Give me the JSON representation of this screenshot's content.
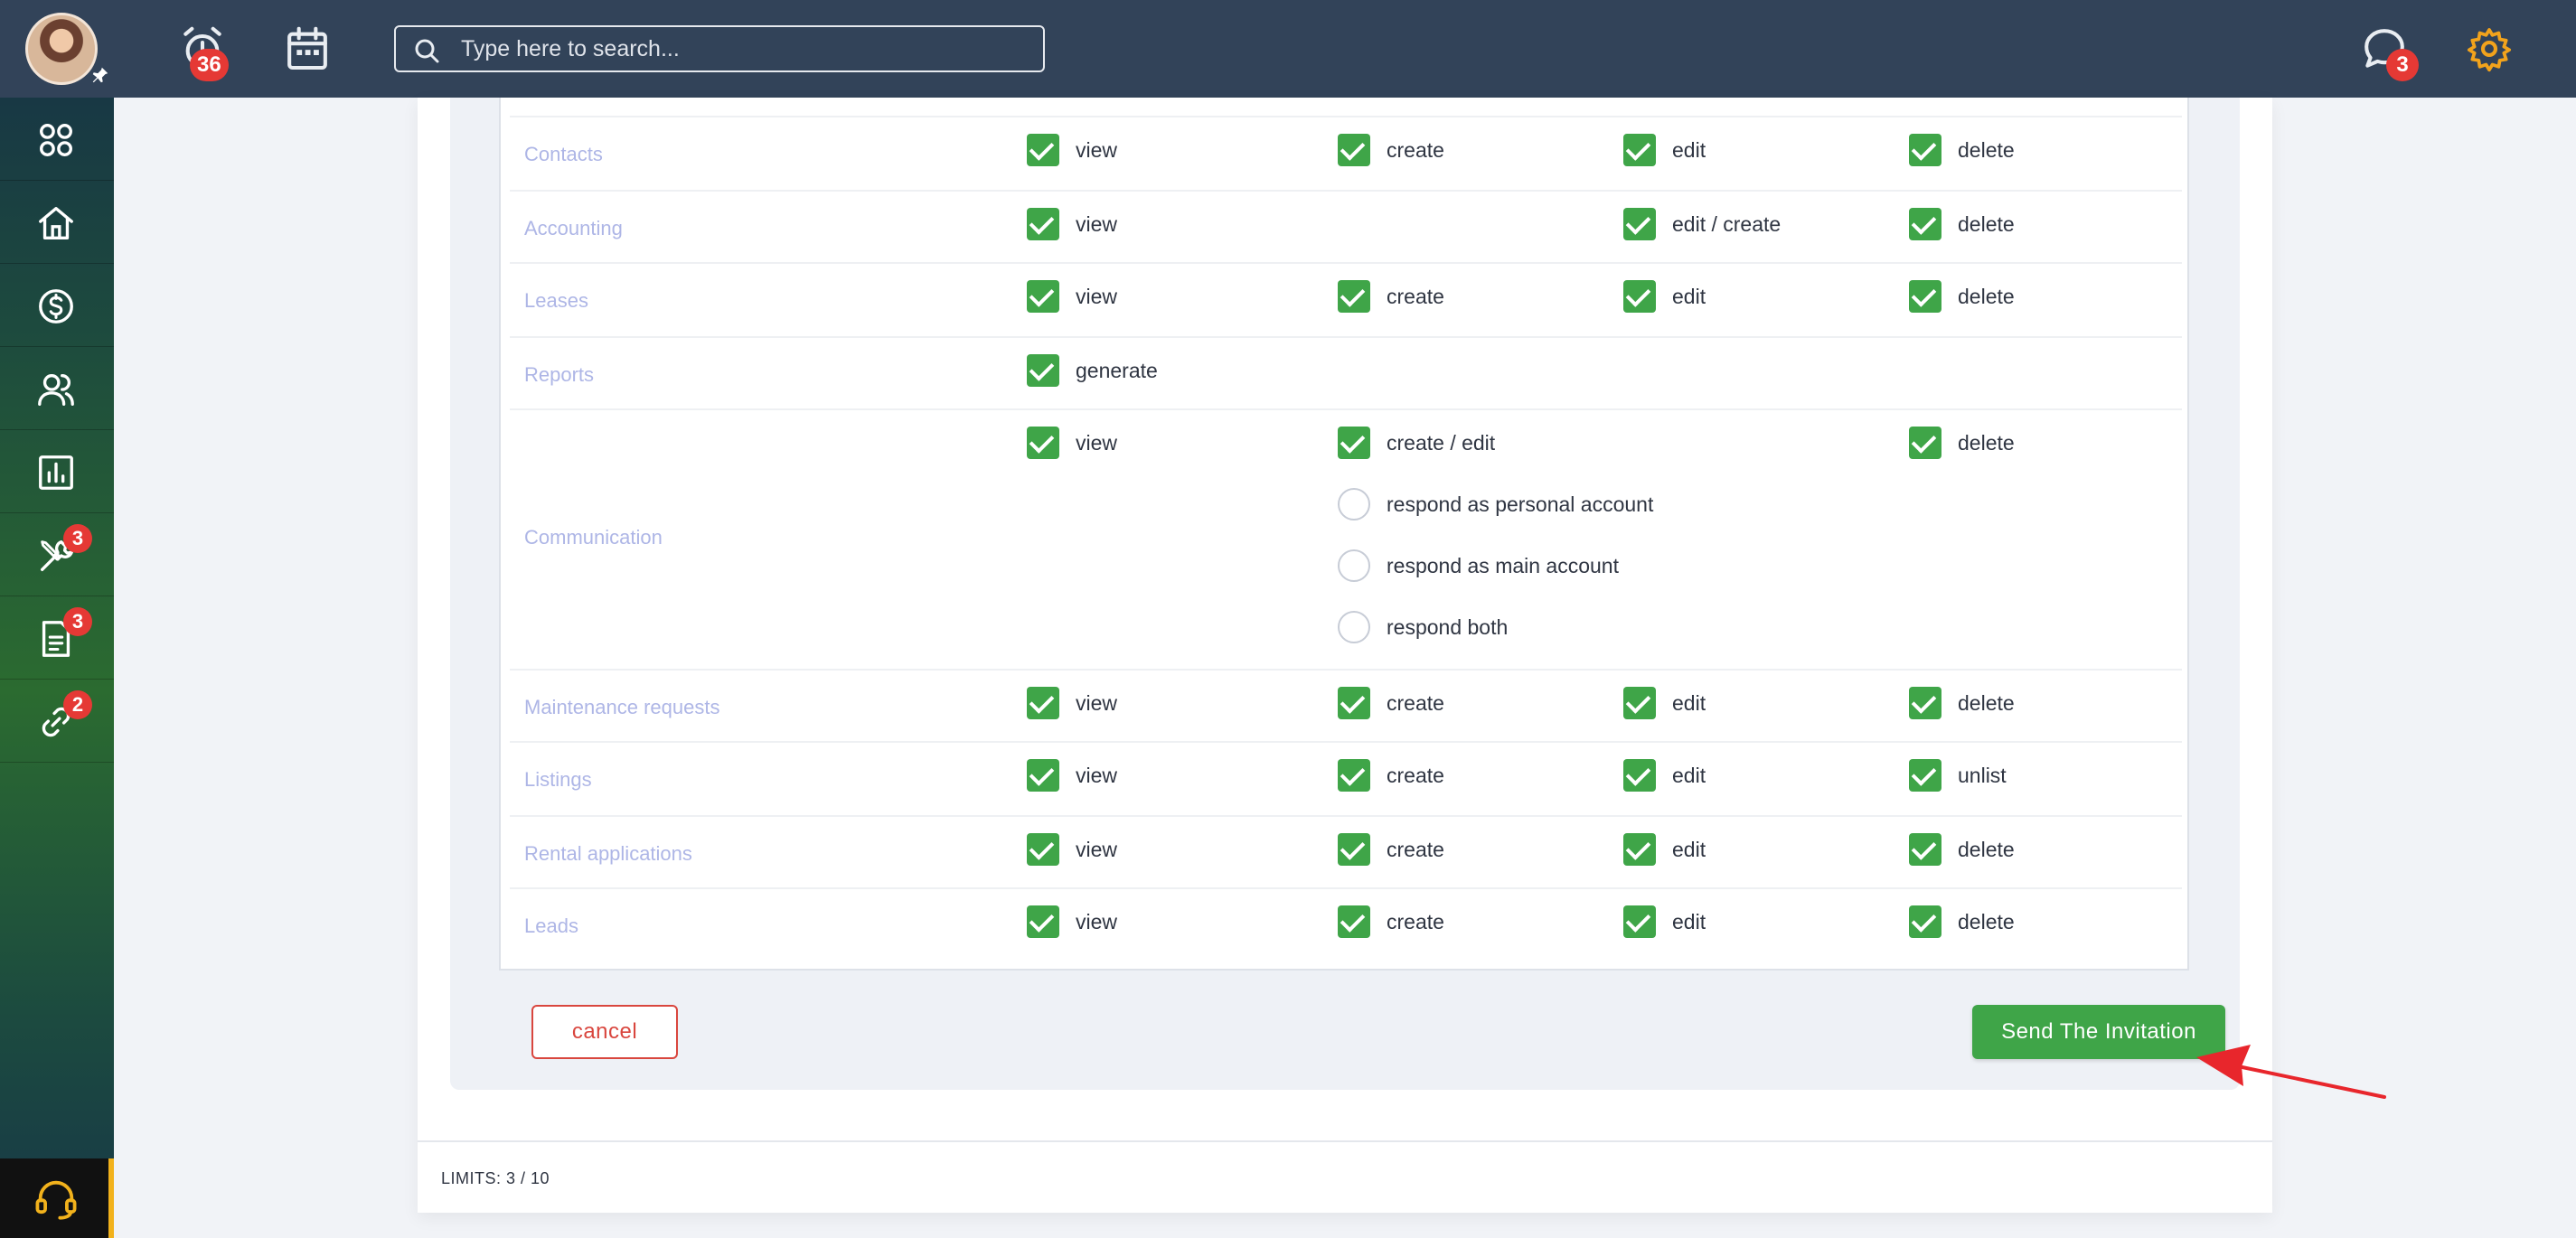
{
  "topbar": {
    "notifications_count": "36",
    "search_placeholder": "Type here to search...",
    "messages_count": "3"
  },
  "sidebar": {
    "items": [
      {
        "icon": "grid-icon",
        "badge": ""
      },
      {
        "icon": "home-icon",
        "badge": ""
      },
      {
        "icon": "dollar-icon",
        "badge": ""
      },
      {
        "icon": "users-icon",
        "badge": ""
      },
      {
        "icon": "chart-icon",
        "badge": ""
      },
      {
        "icon": "tools-icon",
        "badge": "3"
      },
      {
        "icon": "document-icon",
        "badge": "3"
      },
      {
        "icon": "link-icon",
        "badge": "2"
      }
    ],
    "support_icon": "headset-icon"
  },
  "permissions": {
    "rows": [
      {
        "label": "Contacts",
        "options": [
          "view",
          "create",
          "edit",
          "delete"
        ]
      },
      {
        "label": "Accounting",
        "options": [
          "view",
          "edit / create",
          "delete"
        ]
      },
      {
        "label": "Leases",
        "options": [
          "view",
          "create",
          "edit",
          "delete"
        ]
      },
      {
        "label": "Reports",
        "options": [
          "generate"
        ]
      },
      {
        "label": "Communication",
        "options": [
          "view",
          "create / edit",
          "delete"
        ],
        "radios": [
          "respond as personal account",
          "respond as main account",
          "respond both"
        ]
      },
      {
        "label": "Maintenance requests",
        "options": [
          "view",
          "create",
          "edit",
          "delete"
        ]
      },
      {
        "label": "Listings",
        "options": [
          "view",
          "create",
          "edit",
          "unlist"
        ]
      },
      {
        "label": "Rental applications",
        "options": [
          "view",
          "create",
          "edit",
          "delete"
        ]
      },
      {
        "label": "Leads",
        "options": [
          "view",
          "create",
          "edit",
          "delete"
        ]
      }
    ]
  },
  "actions": {
    "cancel_label": "cancel",
    "send_label": "Send The Invitation"
  },
  "footer": {
    "limits": "LIMITS: 3 / 10"
  },
  "colors": {
    "topbar": "#324359",
    "checkbox": "#3fa548",
    "cancel": "#d9463e",
    "settings": "#f2a31c",
    "badge": "#e53935",
    "annotation_arrow": "#e8262c"
  }
}
